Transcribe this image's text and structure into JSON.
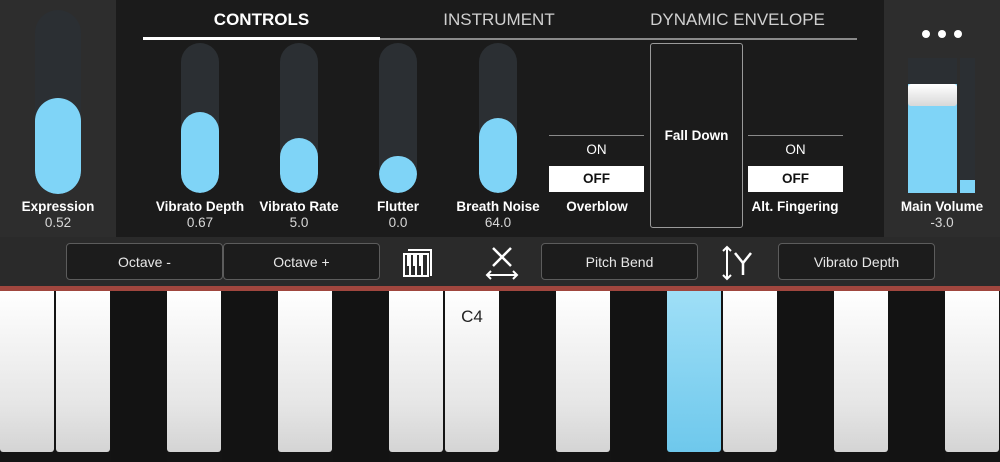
{
  "tabs": [
    {
      "label": "CONTROLS",
      "active": true
    },
    {
      "label": "INSTRUMENT",
      "active": false
    },
    {
      "label": "DYNAMIC ENVELOPE",
      "active": false
    }
  ],
  "expression": {
    "label": "Expression",
    "value": "0.52",
    "level": 0.52
  },
  "sliders": [
    {
      "label": "Vibrato Depth",
      "value": "0.67",
      "level": 0.54
    },
    {
      "label": "Vibrato Rate",
      "value": "5.0",
      "level": 0.37
    },
    {
      "label": "Flutter",
      "value": "0.0",
      "level": 0.25
    },
    {
      "label": "Breath Noise",
      "value": "64.0",
      "level": 0.5
    }
  ],
  "overblow": {
    "label": "Overblow",
    "on": "ON",
    "off": "OFF",
    "selected": "OFF"
  },
  "fall_down": {
    "label": "Fall Down"
  },
  "alt_fingering": {
    "label": "Alt. Fingering",
    "on": "ON",
    "off": "OFF",
    "selected": "OFF"
  },
  "main_volume": {
    "label": "Main Volume",
    "value": "-3.0",
    "level": 0.81,
    "meter_level": 0.1
  },
  "toolbar": {
    "octave_minus": "Octave -",
    "octave_plus": "Octave +",
    "x_assign": "Pitch Bend",
    "y_assign": "Vibrato Depth"
  },
  "keyboard": {
    "octave_label": "C4",
    "active_key": "A4"
  },
  "colors": {
    "accent": "#7fd4f7",
    "divider": "#a0463e"
  },
  "icons": [
    "more-options-icon",
    "keyboard-icon",
    "x-axis-icon",
    "y-axis-icon"
  ]
}
